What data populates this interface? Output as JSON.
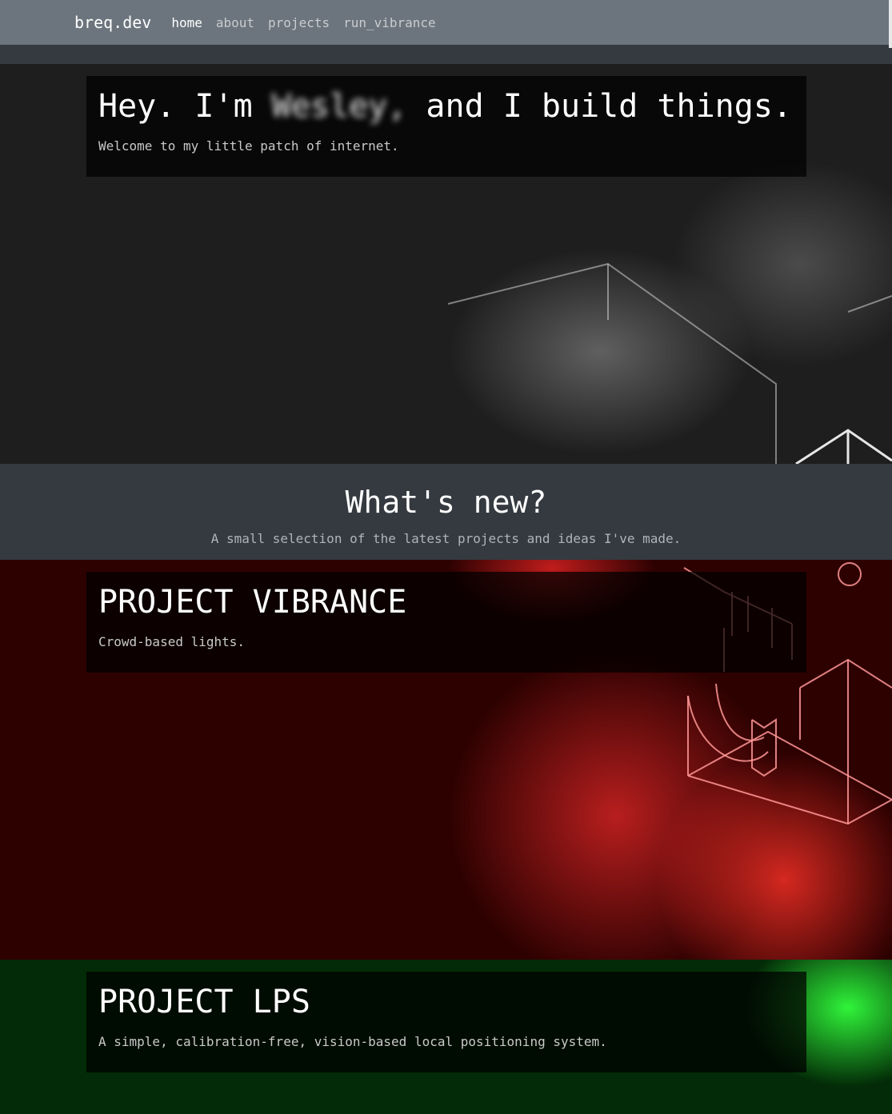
{
  "nav": {
    "brand": "breq.dev",
    "links": [
      {
        "label": "home",
        "active": true
      },
      {
        "label": "about",
        "active": false
      },
      {
        "label": "projects",
        "active": false
      },
      {
        "label": "run_vibrance",
        "active": false
      }
    ]
  },
  "hero": {
    "title_prefix": "Hey. I'm",
    "name_blurred": "Wesley,",
    "title_suffix": "and I build things.",
    "subtitle": "Welcome to my little patch of internet."
  },
  "whats_new": {
    "heading": "What's new?",
    "subtitle": "A small selection of the latest projects and ideas I've made."
  },
  "projects": [
    {
      "title": "PROJECT VIBRANCE",
      "description": "Crowd-based lights."
    },
    {
      "title": "PROJECT LPS",
      "description": "A simple, calibration-free, vision-based local positioning system."
    }
  ],
  "colors": {
    "navbar": "#6c757d",
    "section_dark": "#343a40",
    "hero_bg": "#1e1e1e",
    "vibrance_bg": "#2e0101",
    "vibrance_accent": "#ff3b30",
    "lps_bg": "#032b07",
    "lps_accent": "#33ff3d"
  }
}
